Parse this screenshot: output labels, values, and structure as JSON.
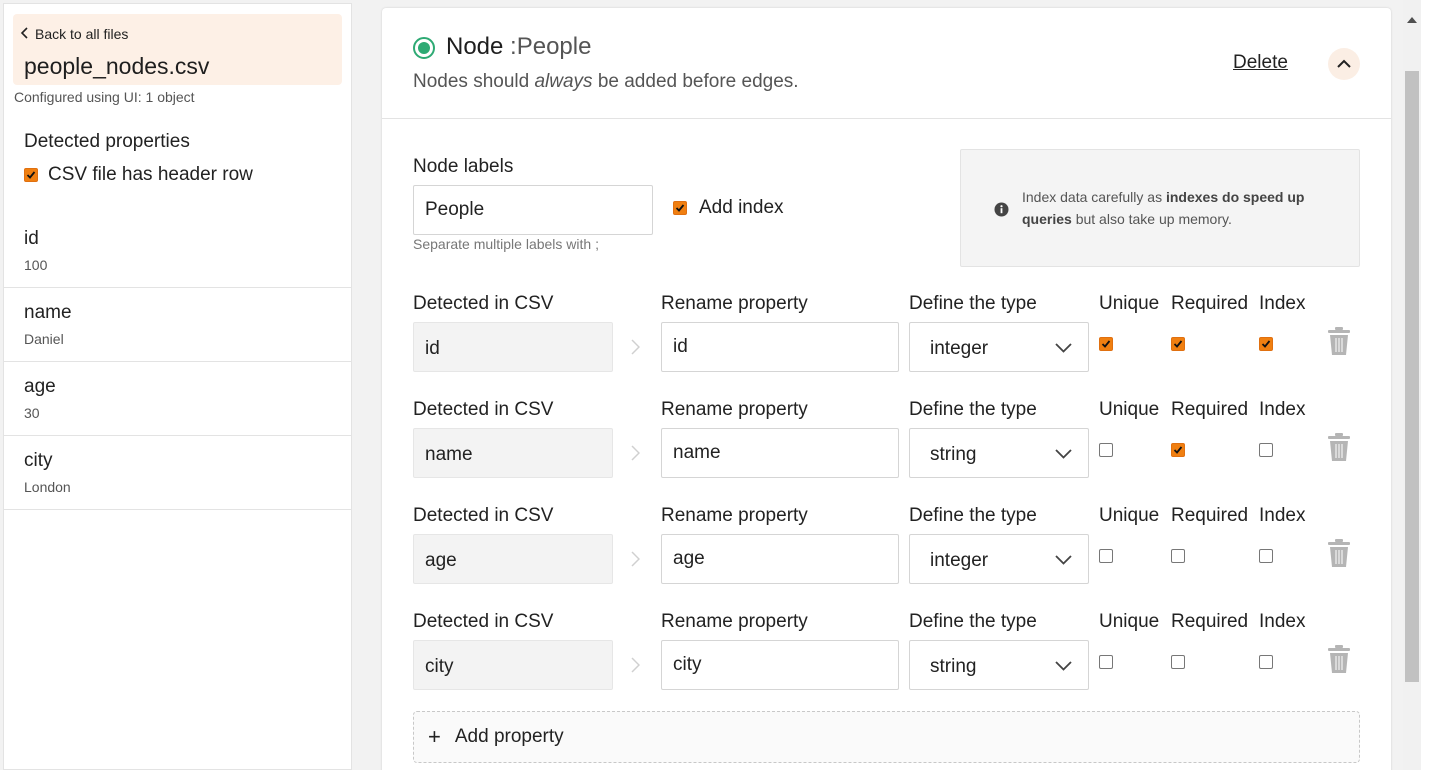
{
  "sidebar": {
    "back_label": "Back to all files",
    "file_name": "people_nodes.csv",
    "config_note": "Configured using UI: 1 object",
    "detected_title": "Detected properties",
    "header_row_label": "CSV file has header row",
    "header_row_checked": true,
    "properties": [
      {
        "name": "id",
        "value": "100"
      },
      {
        "name": "name",
        "value": "Daniel"
      },
      {
        "name": "age",
        "value": "30"
      },
      {
        "name": "city",
        "value": "London"
      }
    ]
  },
  "node": {
    "title": "Node",
    "label_suffix": ":People",
    "subtitle_pre": "Nodes should ",
    "subtitle_em": "always",
    "subtitle_post": " be added before edges.",
    "delete_label": "Delete",
    "status_color": "#2eaa74"
  },
  "node_labels": {
    "label": "Node labels",
    "value": "People",
    "help": "Separate multiple labels with ;",
    "add_index_label": "Add index",
    "add_index_checked": true
  },
  "info": {
    "text_pre": "Index data carefully as ",
    "text_bold_1": "indexes do speed up",
    "text_bold_2": "queries",
    "text_post": " but also take up memory."
  },
  "headers": {
    "detected": "Detected in CSV",
    "rename": "Rename property",
    "type": "Define the type",
    "unique": "Unique",
    "required": "Required",
    "index": "Index"
  },
  "rows": [
    {
      "detected": "id",
      "rename": "id",
      "type": "integer",
      "unique": true,
      "required": true,
      "index": true
    },
    {
      "detected": "name",
      "rename": "name",
      "type": "string",
      "unique": false,
      "required": true,
      "index": false
    },
    {
      "detected": "age",
      "rename": "age",
      "type": "integer",
      "unique": false,
      "required": false,
      "index": false
    },
    {
      "detected": "city",
      "rename": "city",
      "type": "string",
      "unique": false,
      "required": false,
      "index": false
    }
  ],
  "add_property_label": "Add property",
  "colors": {
    "accent": "#f07f10",
    "header_bg": "#fdf0e6"
  }
}
